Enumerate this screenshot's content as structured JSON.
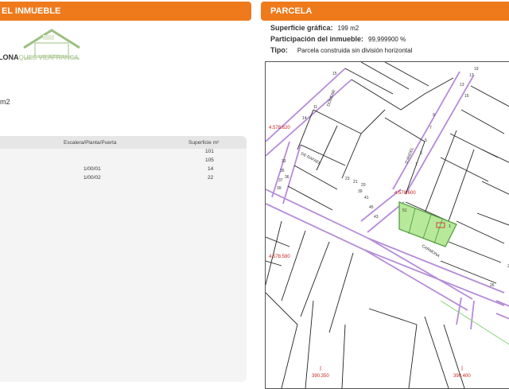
{
  "left_panel": {
    "header": "EL INMUEBLE",
    "logo": {
      "text_main": "LONA",
      "text_sub": "QUES VILAFRANCA"
    },
    "surface_unit": "m2",
    "table": {
      "columns": [
        "Escalera/Planta/Puerta",
        "Superficie m²"
      ],
      "rows": [
        {
          "location": "",
          "surface": "101"
        },
        {
          "location": "",
          "surface": "105"
        },
        {
          "location": "1/00/01",
          "surface": "14"
        },
        {
          "location": "1/00/02",
          "surface": "22"
        }
      ]
    }
  },
  "right_panel": {
    "header": "PARCELA",
    "superficie_label": "Superficie gráfica:",
    "superficie_value": "199 m2",
    "participacion_label": "Participación del inmueble:",
    "participacion_value": "99,999900 %",
    "tipo_label": "Tipo:",
    "tipo_value": "Parcela construida sin división horizontal"
  },
  "map": {
    "coordinate_labels": [
      "4.578.620",
      "4.578.600",
      "4.578.580",
      "390.350",
      "390.400"
    ],
    "street_labels": [
      "DOMENE",
      "DE RAFAEL",
      "D'ANGEL",
      "CARMONA"
    ],
    "number_labels": [
      "15",
      "11",
      "14",
      "13",
      "15",
      "17",
      "19",
      "36",
      "23",
      "21",
      "20",
      "39",
      "41",
      "45",
      "43",
      "9",
      "7",
      "5",
      "3",
      "1",
      "33",
      "35",
      "37",
      "39",
      "26",
      "27",
      "51",
      "1"
    ],
    "colors": {
      "street": "#b58cd8",
      "parcel_fill": "#b8e89a",
      "parcel_border": "#55a044",
      "coordinate": "#cc2222",
      "lines": "#222222"
    }
  }
}
